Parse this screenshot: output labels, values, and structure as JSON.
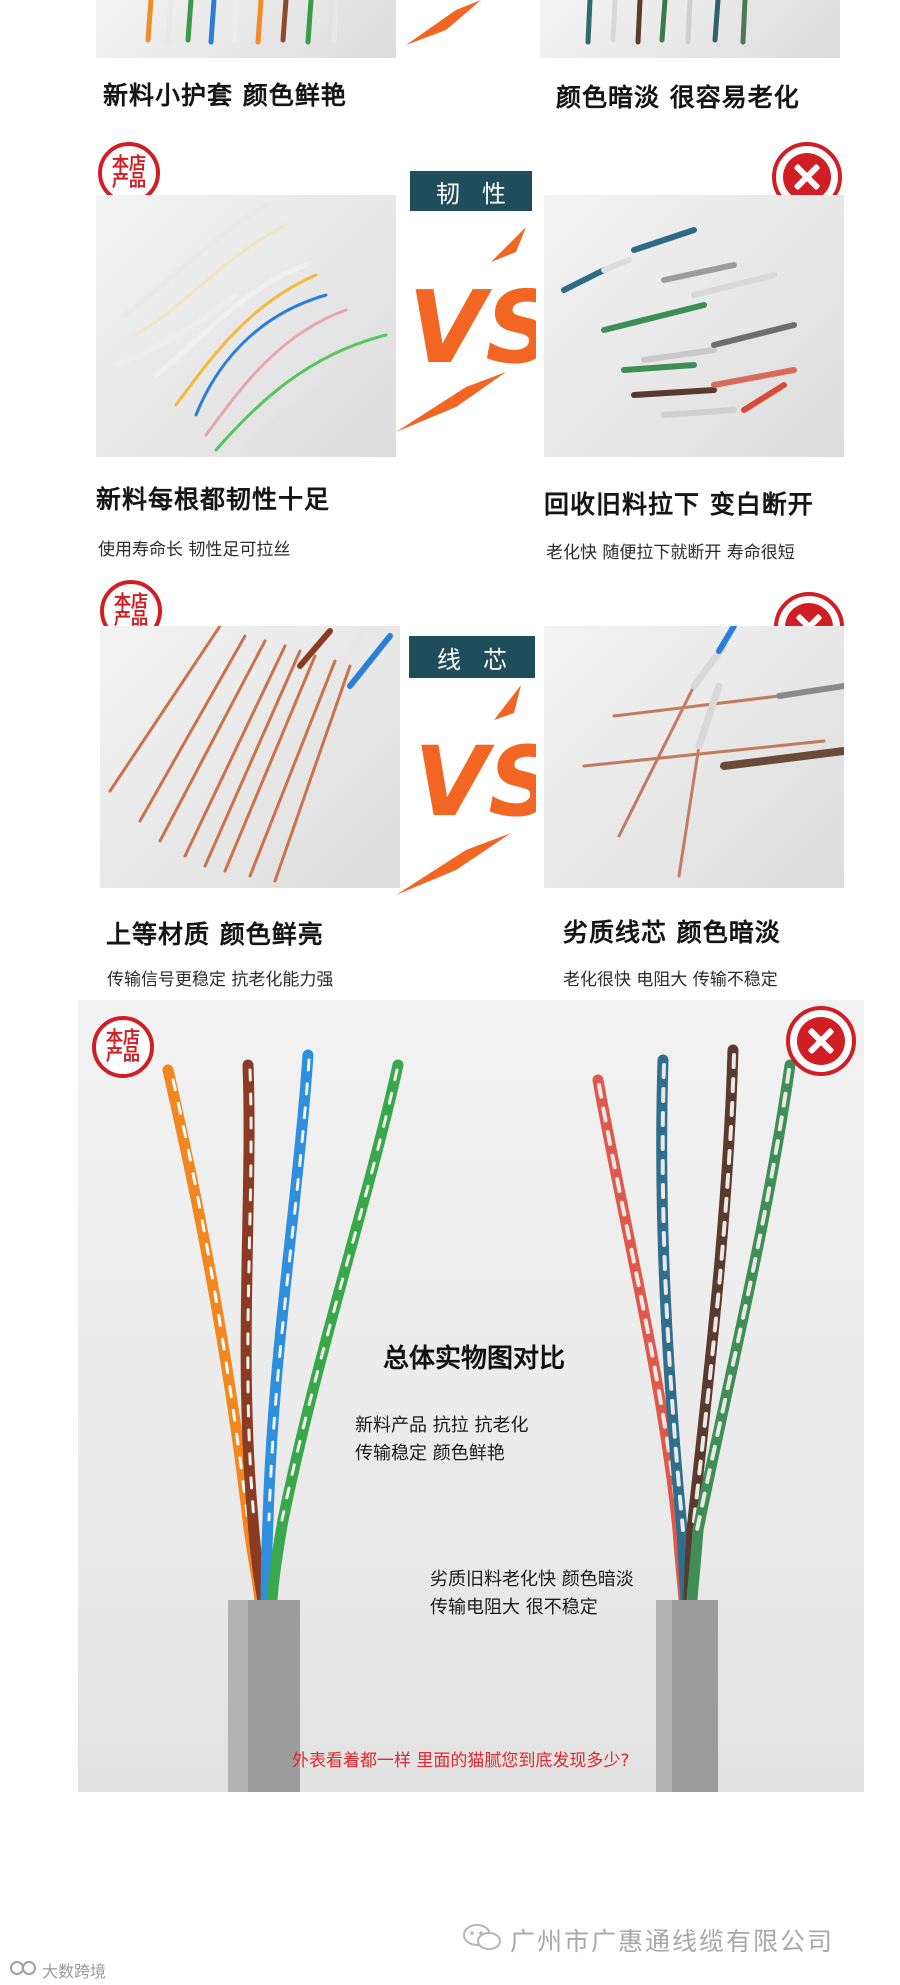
{
  "top": {
    "left_caption": "新料小护套 颜色鲜艳",
    "right_caption": "颜色暗淡 很容易老化"
  },
  "toughness": {
    "label": "韧性",
    "badge_text": [
      "本店",
      "产品"
    ],
    "left_caption": "新料每根都韧性十足",
    "left_sub": "使用寿命长 韧性足可拉丝",
    "right_caption": "回收旧料拉下 变白断开",
    "right_sub": "老化快 随便拉下就断开 寿命很短"
  },
  "core": {
    "label": "线芯",
    "badge_text": [
      "本店",
      "产品"
    ],
    "left_caption": "上等材质 颜色鲜亮",
    "left_sub": "传输信号更稳定 抗老化能力强",
    "right_caption": "劣质线芯 颜色暗淡",
    "right_sub": "老化很快 电阻大 传输不稳定"
  },
  "overview": {
    "badge_text": [
      "本店",
      "产品"
    ],
    "title": "总体实物图对比",
    "good_line1": "新料产品 抗拉 抗老化",
    "good_line2": "传输稳定 颜色鲜艳",
    "bad_line1": "劣质旧料老化快 颜色暗淡",
    "bad_line2": "传输电阻大 很不稳定",
    "bottom_note": "外表看着都一样 里面的猫腻您到底发现多少?"
  },
  "footer": {
    "company": "广州市广惠通线缆有限公司",
    "watermark": "大数跨境"
  },
  "colors": {
    "accent_red": "#d11e25",
    "label_bg": "#1f4d5c",
    "vs_orange": "#f26522"
  }
}
